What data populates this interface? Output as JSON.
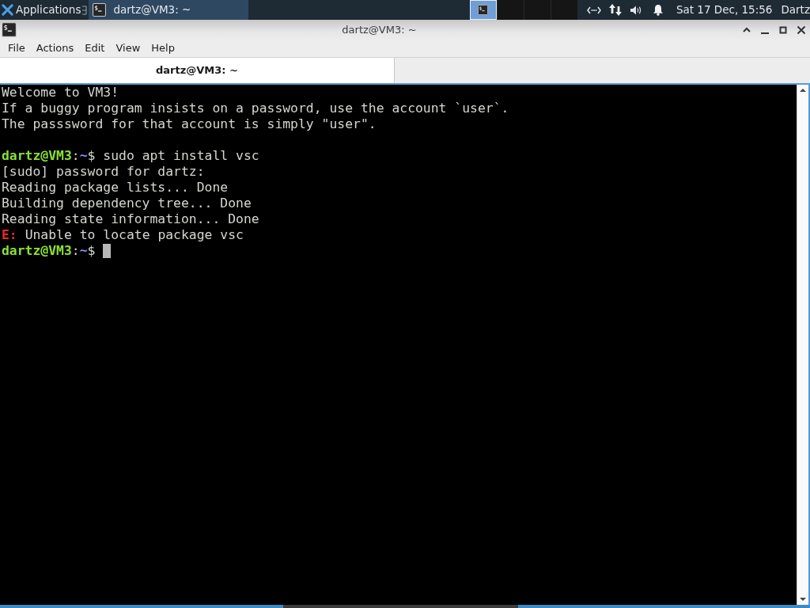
{
  "top_panel": {
    "apps_menu": {
      "label": "Applications"
    },
    "tasks": [
      {
        "label": "dartz@VM3: ~",
        "selected": true
      }
    ],
    "workspaces": [
      {
        "selected": true,
        "has_window": true
      },
      {
        "selected": false
      },
      {
        "selected": false
      },
      {
        "selected": false
      }
    ],
    "clock": "Sat 17 Dec, 15:56",
    "user": "Dartz"
  },
  "window": {
    "title": "dartz@VM3: ~",
    "menu": [
      "File",
      "Actions",
      "Edit",
      "View",
      "Help"
    ],
    "tabs": [
      {
        "label": "dartz@VM3: ~",
        "selected": true
      }
    ]
  },
  "terminal": {
    "lines": [
      {
        "kind": "output",
        "text": "Welcome to VM3!"
      },
      {
        "kind": "output",
        "text": "If a buggy program insists on a password, use the account `user`."
      },
      {
        "kind": "output",
        "text": "The passsword for that account is simply \"user\"."
      },
      {
        "kind": "blank"
      },
      {
        "kind": "prompt",
        "user_host": "dartz@VM3",
        "separator": ":",
        "path": "~",
        "symbol": "$",
        "command": "sudo apt install vsc"
      },
      {
        "kind": "output",
        "text": "[sudo] password for dartz:"
      },
      {
        "kind": "output",
        "text": "Reading package lists... Done"
      },
      {
        "kind": "output",
        "text": "Building dependency tree... Done"
      },
      {
        "kind": "output",
        "text": "Reading state information... Done"
      },
      {
        "kind": "error",
        "tag": "E:",
        "text": "Unable to locate package vsc"
      },
      {
        "kind": "prompt",
        "user_host": "dartz@VM3",
        "separator": ":",
        "path": "~",
        "symbol": "$",
        "cursor": true
      }
    ]
  }
}
